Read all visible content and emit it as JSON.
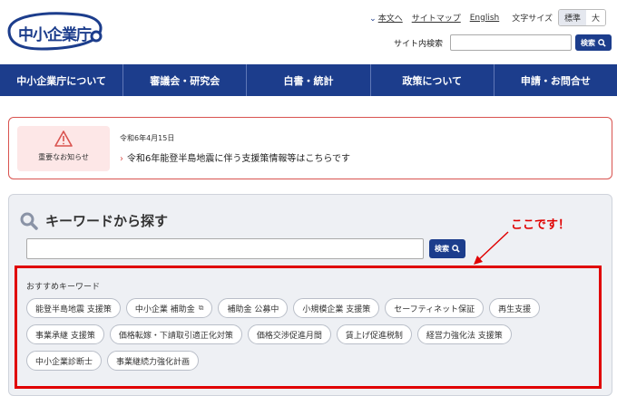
{
  "header": {
    "logo_text": "中小企業庁",
    "util_links": [
      {
        "label": "本文へ",
        "chevron": true
      },
      {
        "label": "サイトマップ",
        "chevron": false
      },
      {
        "label": "English",
        "chevron": false
      }
    ],
    "font_size_label": "文字サイズ",
    "font_sizes": [
      {
        "label": "標準",
        "active": true
      },
      {
        "label": "大",
        "active": false
      }
    ],
    "site_search_label": "サイト内検索",
    "site_search_value": "",
    "site_search_button": "検索"
  },
  "nav": {
    "items": [
      "中小企業庁について",
      "審議会・研究会",
      "白書・統計",
      "政策について",
      "申請・お問合せ"
    ]
  },
  "notice": {
    "label": "重要なお知らせ",
    "date": "令和6年4月15日",
    "link": "令和6年能登半島地震に伴う支援策情報等はこちらです"
  },
  "keyword_search": {
    "title": "キーワードから探す",
    "input_value": "",
    "button": "検索",
    "recommended_label": "おすすめキーワード",
    "keywords": [
      {
        "label": "能登半島地震 支援策",
        "external": false
      },
      {
        "label": "中小企業 補助金",
        "external": true
      },
      {
        "label": "補助金 公募中",
        "external": false
      },
      {
        "label": "小規模企業 支援策",
        "external": false
      },
      {
        "label": "セーフティネット保証",
        "external": false
      },
      {
        "label": "再生支援",
        "external": false
      },
      {
        "label": "事業承継 支援策",
        "external": false
      },
      {
        "label": "価格転嫁・下請取引適正化対策",
        "external": false
      },
      {
        "label": "価格交渉促進月間",
        "external": false
      },
      {
        "label": "賃上げ促進税制",
        "external": false
      },
      {
        "label": "経営力強化法 支援策",
        "external": false
      },
      {
        "label": "中小企業診断士",
        "external": false
      },
      {
        "label": "事業継続力強化計画",
        "external": false
      }
    ]
  },
  "annotation": {
    "text": "ここです！",
    "color": "#e00000"
  },
  "colors": {
    "brand_blue": "#1c3d8c",
    "alert_red": "#d9534f"
  }
}
